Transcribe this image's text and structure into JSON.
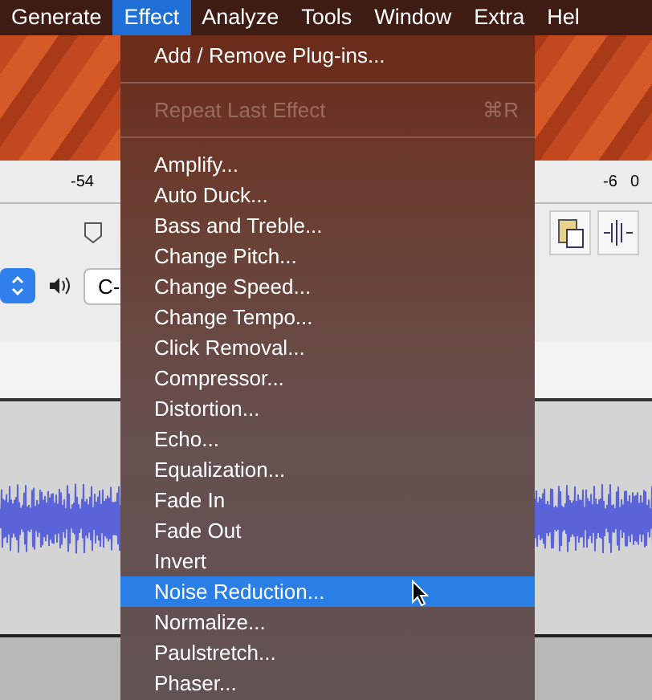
{
  "menu_bar": [
    {
      "label": "Generate",
      "selected": false
    },
    {
      "label": "Effect",
      "selected": true
    },
    {
      "label": "Analyze",
      "selected": false
    },
    {
      "label": "Tools",
      "selected": false
    },
    {
      "label": "Window",
      "selected": false
    },
    {
      "label": "Extra",
      "selected": false
    },
    {
      "label": "Hel",
      "selected": false
    }
  ],
  "meter_ruler": {
    "left_labels": [
      "-54"
    ],
    "right_labels": [
      "-6",
      "0"
    ]
  },
  "device_field": {
    "value": "C-"
  },
  "effect_menu": [
    {
      "kind": "item",
      "label": "Add / Remove Plug-ins...",
      "disabled": false,
      "selected": false
    },
    {
      "kind": "separator"
    },
    {
      "kind": "item",
      "label": "Repeat Last Effect",
      "shortcut": "⌘R",
      "disabled": true,
      "selected": false
    },
    {
      "kind": "separator"
    },
    {
      "kind": "item",
      "label": "Amplify...",
      "disabled": false,
      "selected": false
    },
    {
      "kind": "item",
      "label": "Auto Duck...",
      "disabled": false,
      "selected": false
    },
    {
      "kind": "item",
      "label": "Bass and Treble...",
      "disabled": false,
      "selected": false
    },
    {
      "kind": "item",
      "label": "Change Pitch...",
      "disabled": false,
      "selected": false
    },
    {
      "kind": "item",
      "label": "Change Speed...",
      "disabled": false,
      "selected": false
    },
    {
      "kind": "item",
      "label": "Change Tempo...",
      "disabled": false,
      "selected": false
    },
    {
      "kind": "item",
      "label": "Click Removal...",
      "disabled": false,
      "selected": false
    },
    {
      "kind": "item",
      "label": "Compressor...",
      "disabled": false,
      "selected": false
    },
    {
      "kind": "item",
      "label": "Distortion...",
      "disabled": false,
      "selected": false
    },
    {
      "kind": "item",
      "label": "Echo...",
      "disabled": false,
      "selected": false
    },
    {
      "kind": "item",
      "label": "Equalization...",
      "disabled": false,
      "selected": false
    },
    {
      "kind": "item",
      "label": "Fade In",
      "disabled": false,
      "selected": false
    },
    {
      "kind": "item",
      "label": "Fade Out",
      "disabled": false,
      "selected": false
    },
    {
      "kind": "item",
      "label": "Invert",
      "disabled": false,
      "selected": false
    },
    {
      "kind": "item",
      "label": "Noise Reduction...",
      "disabled": false,
      "selected": true
    },
    {
      "kind": "item",
      "label": "Normalize...",
      "disabled": false,
      "selected": false
    },
    {
      "kind": "item",
      "label": "Paulstretch...",
      "disabled": false,
      "selected": false
    },
    {
      "kind": "item",
      "label": "Phaser...",
      "disabled": false,
      "selected": false
    }
  ]
}
